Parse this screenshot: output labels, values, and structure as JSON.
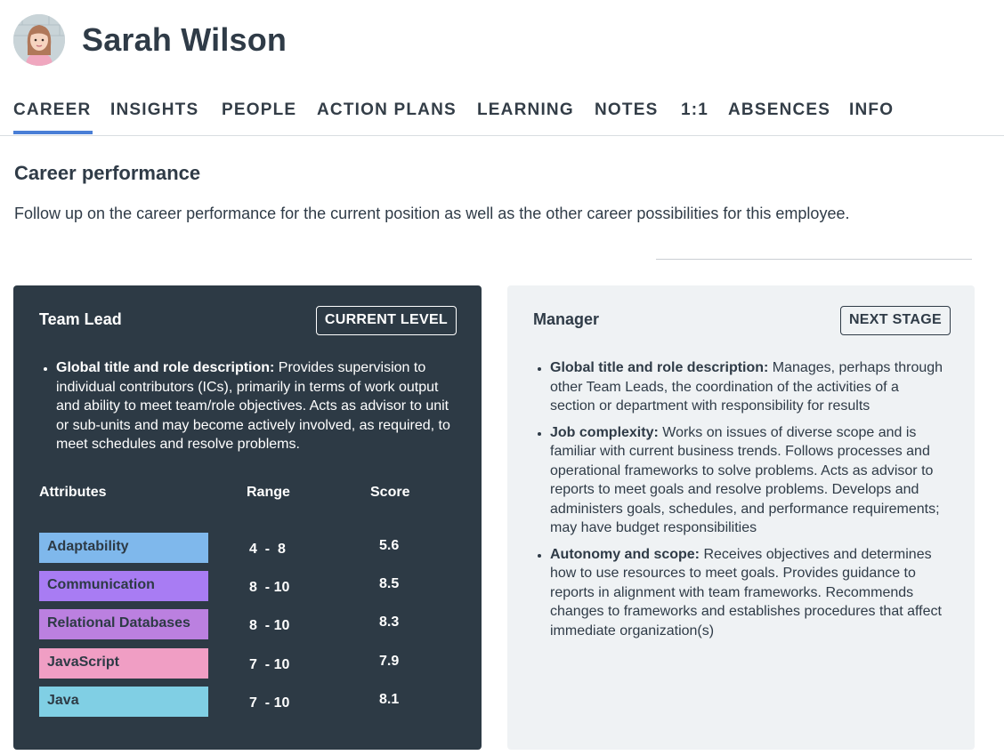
{
  "user": {
    "name": "Sarah Wilson"
  },
  "tabs": [
    {
      "label": "CAREER",
      "active": true
    },
    {
      "label": "INSIGHTS"
    },
    {
      "label": "PEOPLE"
    },
    {
      "label": "ACTION PLANS"
    },
    {
      "label": "LEARNING"
    },
    {
      "label": "NOTES"
    },
    {
      "label": "1:1"
    },
    {
      "label": "ABSENCES"
    },
    {
      "label": "INFO"
    }
  ],
  "section": {
    "title": "Career performance",
    "description": "Follow up on the career performance for the current position as well as the other career possibilities for this employee."
  },
  "current": {
    "title": "Team Lead",
    "badge": "CURRENT LEVEL",
    "items": [
      {
        "label": "Global title and role description:",
        "text": " Provides supervision to individual contributors (ICs), primarily in terms of work output and ability to meet team/role objectives. Acts as advisor to unit or sub-units and may become actively involved, as required, to meet schedules and resolve problems."
      }
    ],
    "table_headers": {
      "attributes": "Attributes",
      "range": "Range",
      "score": "Score"
    },
    "attributes": [
      {
        "name": "Adaptability",
        "range_min": "4",
        "range_sep": "-",
        "range_max": "8",
        "score": "5.6",
        "color": "#7fb8ec"
      },
      {
        "name": "Communication",
        "range_min": "8",
        "range_sep": "-",
        "range_max": "10",
        "score": "8.5",
        "color": "#a87cf3"
      },
      {
        "name": "Relational Databases",
        "range_min": "8",
        "range_sep": "-",
        "range_max": "10",
        "score": "8.3",
        "color": "#bb80e0"
      },
      {
        "name": "JavaScript",
        "range_min": "7",
        "range_sep": "-",
        "range_max": "10",
        "score": "7.9",
        "color": "#f09ec4"
      },
      {
        "name": "Java",
        "range_min": "7",
        "range_sep": "-",
        "range_max": "10",
        "score": "8.1",
        "color": "#80cfe4"
      }
    ]
  },
  "next": {
    "title": "Manager",
    "badge": "NEXT STAGE",
    "items": [
      {
        "label": "Global title and role description:",
        "text": " Manages, perhaps through other Team Leads, the coordination of the activities of a section or department with responsibility for results"
      },
      {
        "label": "Job complexity:",
        "text": " Works on issues of diverse scope and is familiar with current business trends. Follows processes and operational frameworks to solve problems. Acts as advisor to reports to meet goals and resolve problems. Develops and administers goals, schedules, and performance requirements; may have budget responsibilities"
      },
      {
        "label": "Autonomy and scope:",
        "text": " Receives objectives and determines how to use resources to meet goals. Provides guidance to reports in alignment with team frameworks. Recommends changes to frameworks and establishes procedures that affect immediate organization(s)"
      }
    ]
  },
  "colors": {
    "accent": "#4a7fd6",
    "dark_card": "#2d3a45",
    "light_card": "#eff2f4"
  }
}
